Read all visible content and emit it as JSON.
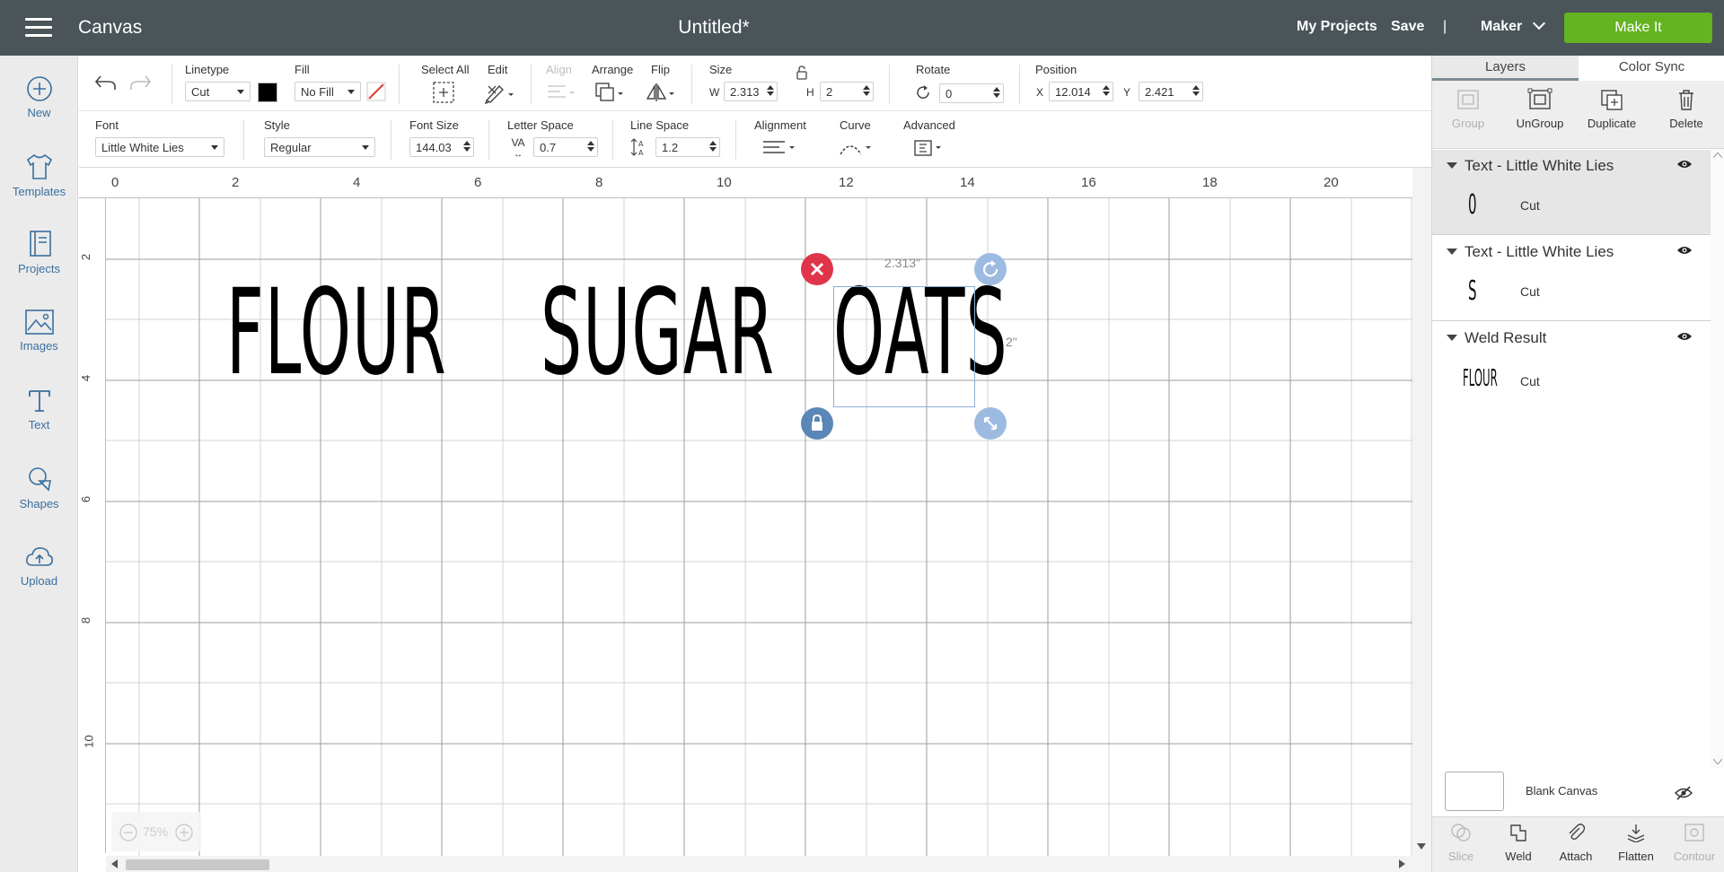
{
  "topbar": {
    "app_name": "Canvas",
    "doc_title": "Untitled*",
    "my_projects": "My Projects",
    "save": "Save",
    "separator": "|",
    "machine": "Maker",
    "make_it": "Make It",
    "accent_color": "#64b320"
  },
  "leftbar": {
    "items": [
      {
        "label": "New",
        "icon": "plus-circle-icon"
      },
      {
        "label": "Templates",
        "icon": "tshirt-icon"
      },
      {
        "label": "Projects",
        "icon": "book-icon"
      },
      {
        "label": "Images",
        "icon": "image-icon"
      },
      {
        "label": "Text",
        "icon": "text-icon"
      },
      {
        "label": "Shapes",
        "icon": "shapes-icon"
      },
      {
        "label": "Upload",
        "icon": "cloud-upload-icon"
      }
    ]
  },
  "toolbar1": {
    "linetype_label": "Linetype",
    "linetype_value": "Cut",
    "fill_label": "Fill",
    "fill_value": "No Fill",
    "select_all_label": "Select All",
    "edit_label": "Edit",
    "align_label": "Align",
    "arrange_label": "Arrange",
    "flip_label": "Flip",
    "size_label": "Size",
    "w_label": "W",
    "w_value": "2.313",
    "h_label": "H",
    "h_value": "2",
    "rotate_label": "Rotate",
    "rotate_value": "0",
    "position_label": "Position",
    "x_label": "X",
    "x_value": "12.014",
    "y_label": "Y",
    "y_value": "2.421",
    "swatch_color": "#000000"
  },
  "toolbar2": {
    "font_label": "Font",
    "font_value": "Little White Lies",
    "style_label": "Style",
    "style_value": "Regular",
    "font_size_label": "Font Size",
    "font_size_value": "144.03",
    "letter_space_label": "Letter Space",
    "letter_space_value": "0.7",
    "line_space_label": "Line Space",
    "line_space_value": "1.2",
    "alignment_label": "Alignment",
    "curve_label": "Curve",
    "advanced_label": "Advanced",
    "va_glyph": "VA"
  },
  "canvas": {
    "ruler_top": [
      "0",
      "2",
      "4",
      "6",
      "8",
      "10",
      "12",
      "14",
      "16",
      "18",
      "20"
    ],
    "ruler_left": [
      "2",
      "4",
      "6",
      "8",
      "10"
    ],
    "words": [
      "FLOUR",
      "SUGAR",
      "OATS"
    ],
    "width_label": "2.313\"",
    "height_label": "2\"",
    "zoom": "75%"
  },
  "rightpanel": {
    "tabs": [
      "Layers",
      "Color Sync"
    ],
    "tools": [
      {
        "label": "Group",
        "enabled": false
      },
      {
        "label": "UnGroup",
        "enabled": true
      },
      {
        "label": "Duplicate",
        "enabled": true
      },
      {
        "label": "Delete",
        "enabled": true
      }
    ],
    "layers": [
      {
        "name": "Text - Little White Lies",
        "item_label": "Cut",
        "thumb": "0"
      },
      {
        "name": "Text - Little White Lies",
        "item_label": "Cut",
        "thumb": "S"
      },
      {
        "name": "Weld Result",
        "item_label": "Cut",
        "thumb": "FLOUR"
      }
    ],
    "blank_canvas": "Blank Canvas",
    "bottom_tools": [
      {
        "label": "Slice",
        "enabled": false
      },
      {
        "label": "Weld",
        "enabled": true
      },
      {
        "label": "Attach",
        "enabled": true
      },
      {
        "label": "Flatten",
        "enabled": true
      },
      {
        "label": "Contour",
        "enabled": false
      }
    ]
  }
}
